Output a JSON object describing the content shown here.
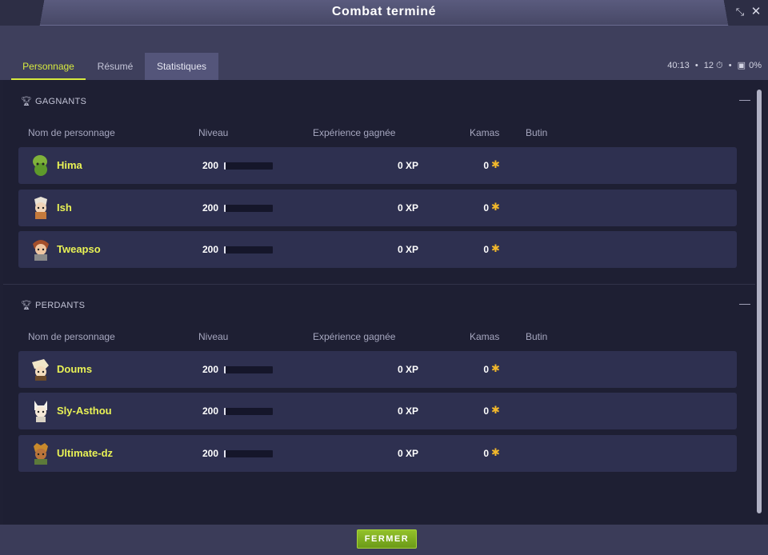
{
  "window": {
    "title": "Combat terminé"
  },
  "tabs": [
    {
      "label": "Personnage",
      "active": true
    },
    {
      "label": "Résumé",
      "active": false
    },
    {
      "label": "Statistiques",
      "active": false
    }
  ],
  "fight_info": {
    "duration": "40:13",
    "sep1": "•",
    "turns": "12 ⏱",
    "sep2": "•",
    "percent": "0%"
  },
  "columns": {
    "name": "Nom de personnage",
    "level": "Niveau",
    "xp": "Expérience gagnée",
    "kamas": "Kamas",
    "loot": "Butin"
  },
  "winners": {
    "title": "GAGNANTS",
    "rows": [
      {
        "name": "Hima",
        "level": "200",
        "xp": "0 XP",
        "kamas": "0"
      },
      {
        "name": "Ish",
        "level": "200",
        "xp": "0 XP",
        "kamas": "0"
      },
      {
        "name": "Tweapso",
        "level": "200",
        "xp": "0 XP",
        "kamas": "0"
      }
    ]
  },
  "losers": {
    "title": "PERDANTS",
    "rows": [
      {
        "name": "Doums",
        "level": "200",
        "xp": "0 XP",
        "kamas": "0"
      },
      {
        "name": "Sly-Asthou",
        "level": "200",
        "xp": "0 XP",
        "kamas": "0"
      },
      {
        "name": "Ultimate-dz",
        "level": "200",
        "xp": "0 XP",
        "kamas": "0"
      }
    ]
  },
  "footer": {
    "close_label": "FERMER"
  },
  "colors": {
    "accent": "#d7ea3f",
    "kama": "#f2b82b",
    "button": "#7fae20"
  }
}
